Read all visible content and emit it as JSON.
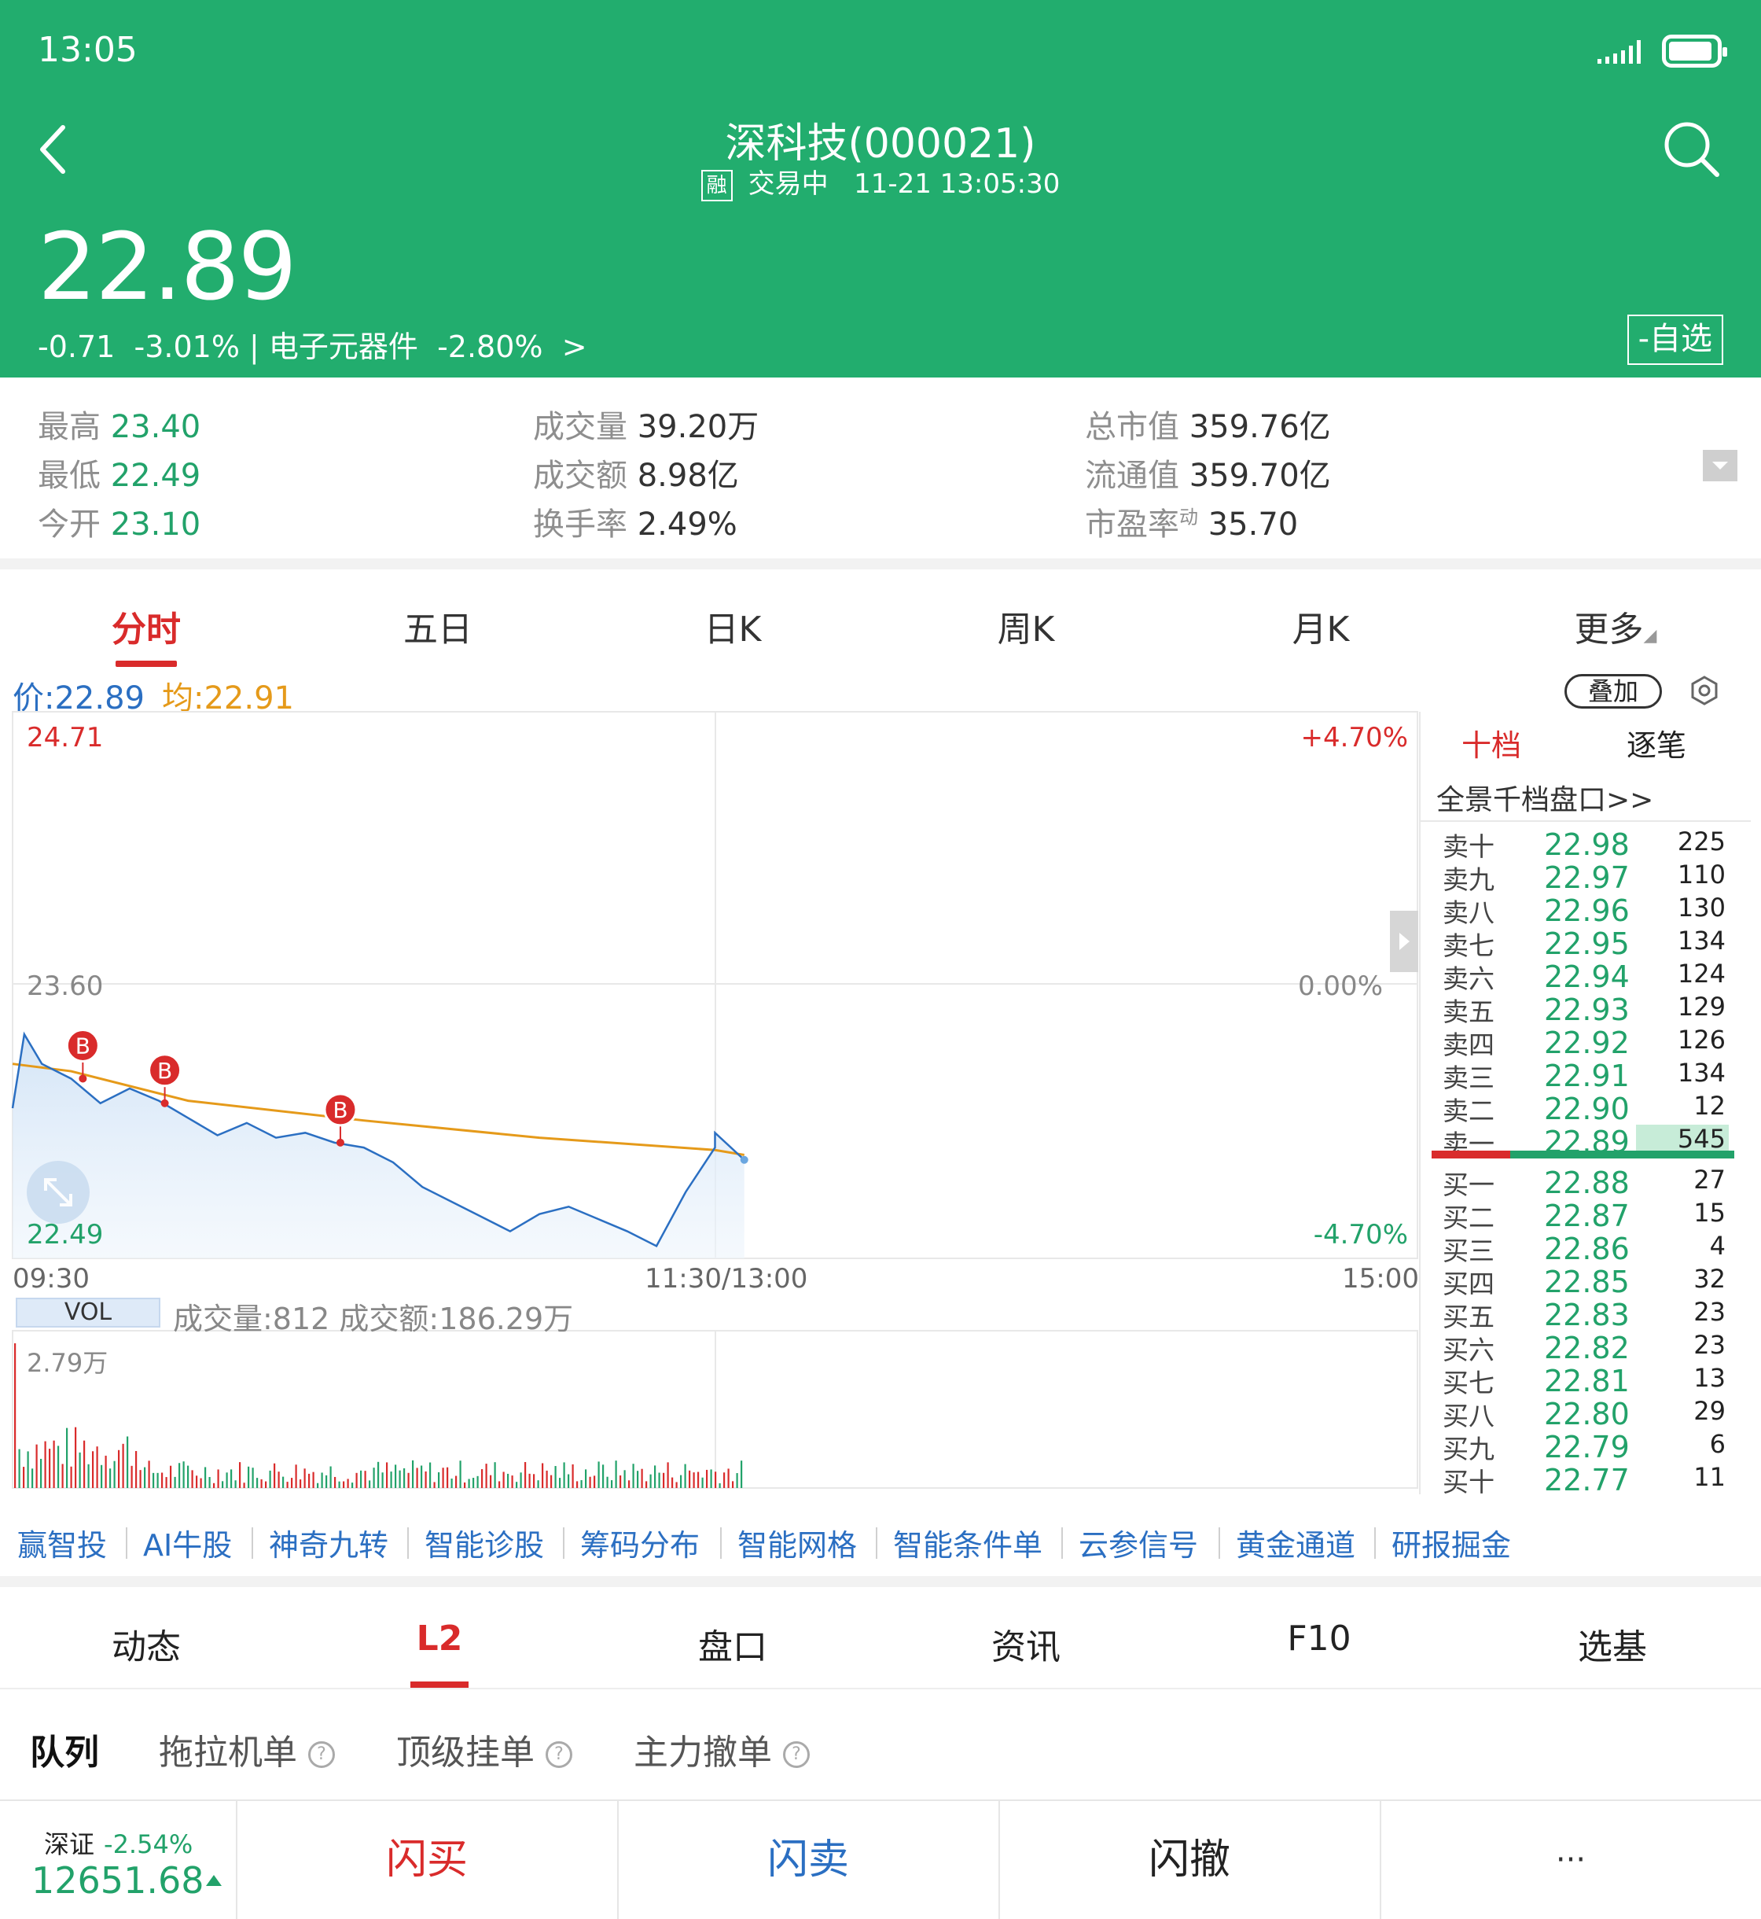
{
  "status": {
    "time": "13:05"
  },
  "header": {
    "title": "深科技(000021)",
    "margin_badge": "融",
    "trade_status": "交易中",
    "datetime": "11-21 13:05:30",
    "price": "22.89",
    "change": "-0.71",
    "change_pct": "-3.01%",
    "sector": "| 电子元器件",
    "sector_pct": "-2.80%",
    "sector_arrow": ">",
    "fav_button": "-自选"
  },
  "stats": {
    "high_label": "最高",
    "high": "23.40",
    "low_label": "最低",
    "low": "22.49",
    "open_label": "今开",
    "open": "23.10",
    "volume_label": "成交量",
    "volume": "39.20万",
    "amount_label": "成交额",
    "amount": "8.98亿",
    "turnover_label": "换手率",
    "turnover": "2.49%",
    "mcap_label": "总市值",
    "mcap": "359.76亿",
    "float_label": "流通值",
    "float": "359.70亿",
    "pe_label": "市盈率",
    "pe_sup": "动",
    "pe": "35.70"
  },
  "chart_tabs": [
    "分时",
    "五日",
    "日K",
    "周K",
    "月K",
    "更多"
  ],
  "chart_info": {
    "price": "价:22.89",
    "avg": "均:22.91",
    "overlay": "叠加"
  },
  "axis": {
    "y_top": "24.71",
    "y_mid": "23.60",
    "y_bottom": "22.49",
    "pct_top": "+4.70%",
    "pct_mid": "0.00%",
    "pct_bottom": "-4.70%",
    "x_start": "09:30",
    "x_mid": "11:30/13:00",
    "x_end": "15:00"
  },
  "vol_info": {
    "label": "VOL",
    "text": "成交量:812 成交额:186.29万",
    "max": "2.79万"
  },
  "trade_marker": "B",
  "colors": {
    "header_green": "#22ad6e",
    "up_red": "#d92b2b",
    "down_green": "#22a26a",
    "price_line": "#2b6fc2",
    "avg_line": "#e59a1a"
  },
  "chart_data": {
    "type": "line",
    "x_range": [
      "09:30",
      "15:00"
    ],
    "ylim": [
      22.49,
      24.71
    ],
    "prev_close": 23.6,
    "series": [
      {
        "x": [
          "09:30",
          "09:32",
          "09:35",
          "09:40",
          "09:45",
          "09:50",
          "09:55",
          "10:00",
          "10:05",
          "10:10",
          "10:15",
          "10:20",
          "10:25",
          "10:30",
          "10:35",
          "10:40",
          "10:45",
          "10:50",
          "10:55",
          "11:00",
          "11:05",
          "11:10",
          "11:15",
          "11:20",
          "11:25",
          "11:30",
          "13:00",
          "13:05"
        ],
        "values": [
          23.1,
          23.4,
          23.28,
          23.22,
          23.12,
          23.18,
          23.13,
          23.06,
          22.99,
          23.04,
          22.98,
          23.0,
          22.96,
          22.94,
          22.88,
          22.78,
          22.72,
          22.66,
          22.6,
          22.67,
          22.7,
          22.65,
          22.6,
          22.54,
          22.76,
          22.94,
          23.0,
          22.89
        ]
      },
      {
        "x": [
          "09:30",
          "09:40",
          "10:00",
          "10:30",
          "11:00",
          "11:30",
          "13:05"
        ],
        "values": [
          23.28,
          23.25,
          23.13,
          23.05,
          22.98,
          22.93,
          22.91
        ]
      }
    ]
  },
  "order_book": {
    "tabs": [
      "十档",
      "逐笔"
    ],
    "link": "全景千档盘口>>",
    "asks": [
      {
        "name": "卖十",
        "price": "22.98",
        "vol": "225"
      },
      {
        "name": "卖九",
        "price": "22.97",
        "vol": "110"
      },
      {
        "name": "卖八",
        "price": "22.96",
        "vol": "130"
      },
      {
        "name": "卖七",
        "price": "22.95",
        "vol": "134"
      },
      {
        "name": "卖六",
        "price": "22.94",
        "vol": "124"
      },
      {
        "name": "卖五",
        "price": "22.93",
        "vol": "129"
      },
      {
        "name": "卖四",
        "price": "22.92",
        "vol": "126"
      },
      {
        "name": "卖三",
        "price": "22.91",
        "vol": "134"
      },
      {
        "name": "卖二",
        "price": "22.90",
        "vol": "12"
      },
      {
        "name": "卖一",
        "price": "22.89",
        "vol": "545"
      }
    ],
    "bids": [
      {
        "name": "买一",
        "price": "22.88",
        "vol": "27"
      },
      {
        "name": "买二",
        "price": "22.87",
        "vol": "15"
      },
      {
        "name": "买三",
        "price": "22.86",
        "vol": "4"
      },
      {
        "name": "买四",
        "price": "22.85",
        "vol": "32"
      },
      {
        "name": "买五",
        "price": "22.83",
        "vol": "23"
      },
      {
        "name": "买六",
        "price": "22.82",
        "vol": "23"
      },
      {
        "name": "买七",
        "price": "22.81",
        "vol": "13"
      },
      {
        "name": "买八",
        "price": "22.80",
        "vol": "29"
      },
      {
        "name": "买九",
        "price": "22.79",
        "vol": "6"
      },
      {
        "name": "买十",
        "price": "22.77",
        "vol": "11"
      }
    ]
  },
  "tools": [
    "赢智投",
    "AI牛股",
    "神奇九转",
    "智能诊股",
    "筹码分布",
    "智能网格",
    "智能条件单",
    "云参信号",
    "黄金通道",
    "研报掘金"
  ],
  "bottom_tabs": [
    "动态",
    "L2",
    "盘口",
    "资讯",
    "F10",
    "选基"
  ],
  "sub_tabs": [
    "队列",
    "拖拉机单",
    "顶级挂单",
    "主力撤单"
  ],
  "help_mark": "?",
  "index": {
    "name": "深证",
    "change": "-2.54%",
    "value": "12651.68"
  },
  "actions": {
    "buy": "闪买",
    "sell": "闪卖",
    "cancel": "闪撤",
    "more": "···"
  }
}
